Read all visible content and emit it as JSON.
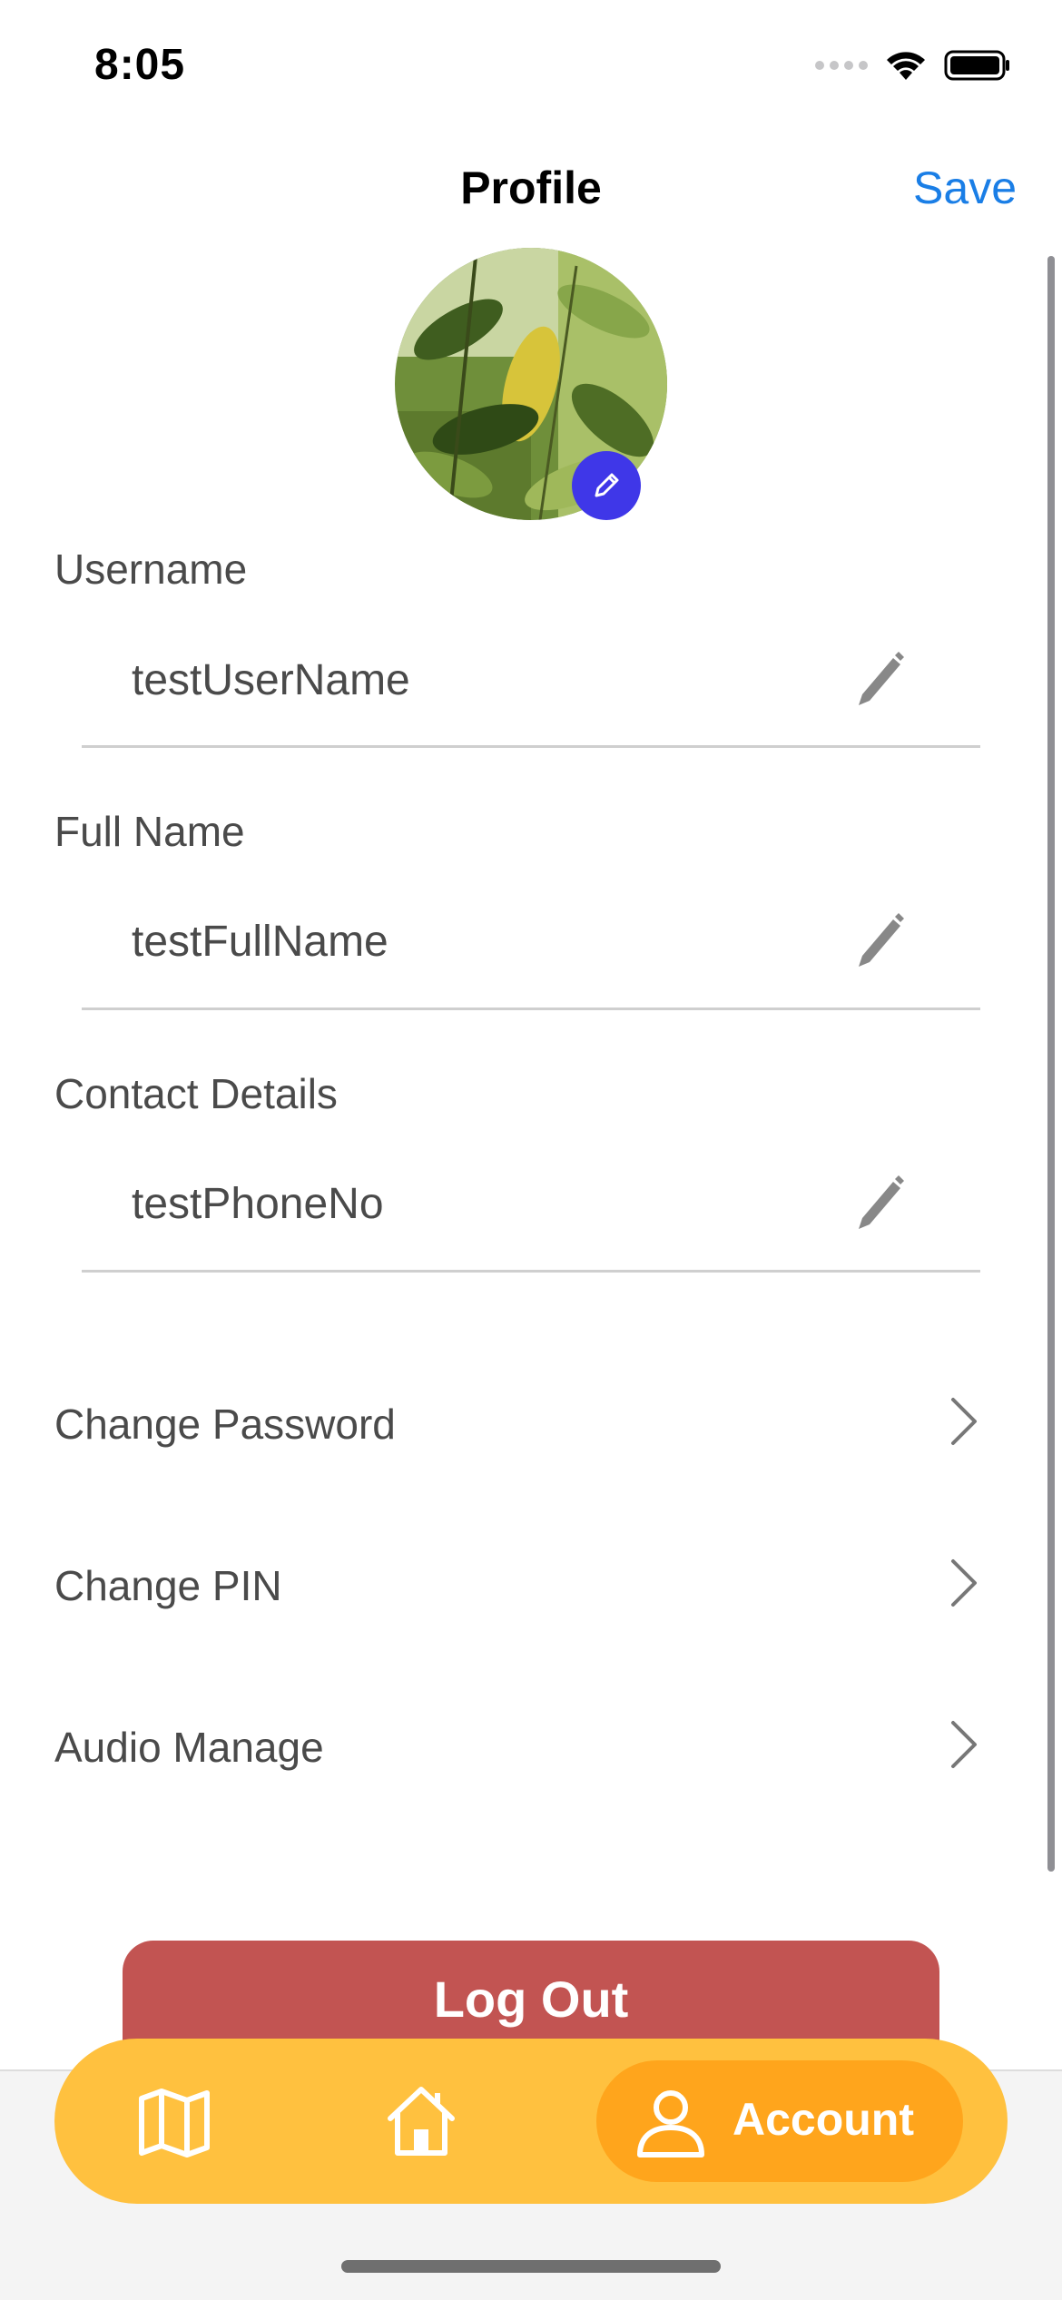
{
  "status_bar": {
    "time": "8:05"
  },
  "nav": {
    "title": "Profile",
    "save_label": "Save"
  },
  "fields": [
    {
      "label": "Username",
      "value": "testUserName"
    },
    {
      "label": "Full Name",
      "value": "testFullName"
    },
    {
      "label": "Contact Details",
      "value": "testPhoneNo"
    }
  ],
  "menu": [
    {
      "label": "Change Password"
    },
    {
      "label": "Change PIN"
    },
    {
      "label": "Audio Manage"
    }
  ],
  "logout_label": "Log Out",
  "tabbar": {
    "tabs": [
      {
        "icon": "map-icon"
      },
      {
        "icon": "home-icon"
      },
      {
        "icon": "person-icon",
        "label": "Account",
        "active": true
      }
    ]
  },
  "colors": {
    "accent": "#1a7ee6",
    "avatar_edit": "#3f37e8",
    "logout": "#c25452",
    "tabbar": "#ffc13f",
    "tab_active": "#ffa51c"
  }
}
